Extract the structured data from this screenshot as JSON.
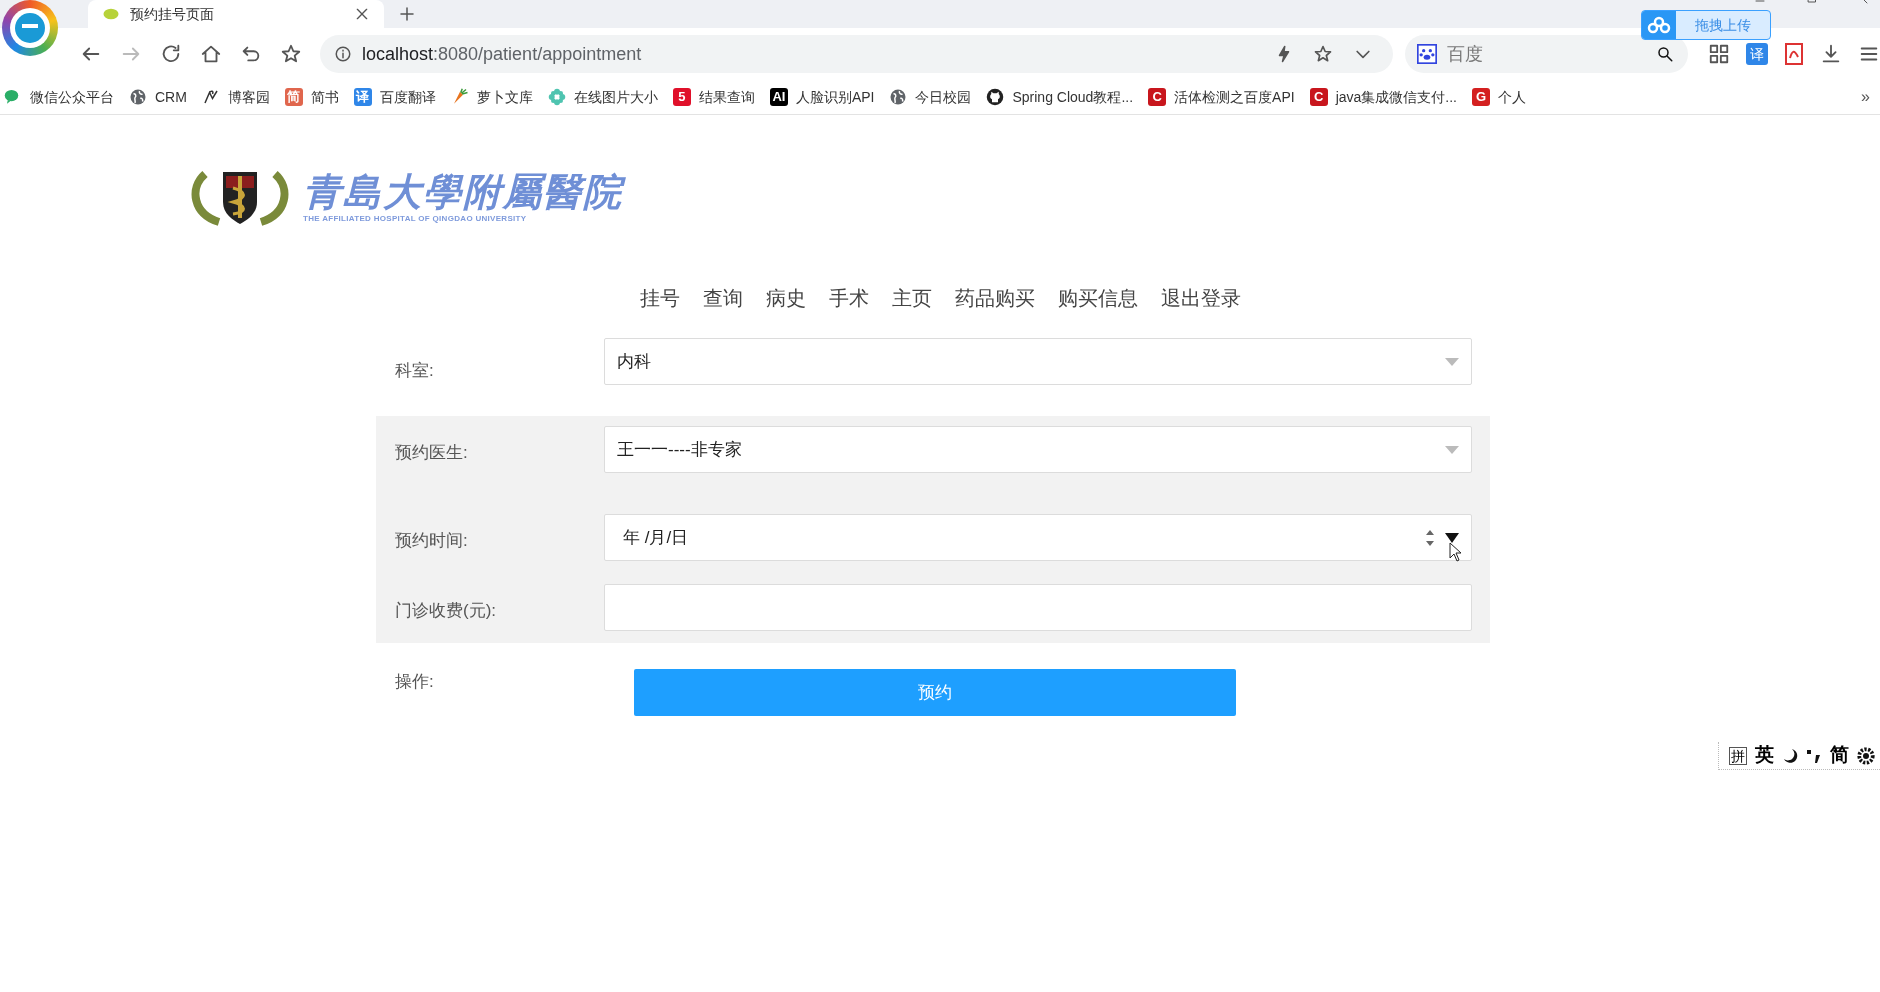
{
  "browser": {
    "tab_title": "预约挂号页面",
    "url_host": "localhost",
    "url_path": ":8080/patient/appointment",
    "search_placeholder": "百度",
    "upload_button": "拖拽上传",
    "translate_badge": "译",
    "bookmarks": [
      {
        "kind": "wechat",
        "label": "微信公众平台"
      },
      {
        "kind": "globe",
        "label": "CRM"
      },
      {
        "kind": "pen",
        "label": "博客园"
      },
      {
        "kind": "badge",
        "badge": "简",
        "color": "#e0664d",
        "label": "简书"
      },
      {
        "kind": "badge",
        "badge": "译",
        "color": "#2f86e8",
        "label": "百度翻译"
      },
      {
        "kind": "carrot",
        "label": "萝卜文库"
      },
      {
        "kind": "flower",
        "label": "在线图片大小"
      },
      {
        "kind": "badge",
        "badge": "5",
        "color": "#e0102a",
        "label": "结果查询"
      },
      {
        "kind": "badge",
        "badge": "AI",
        "color": "#000000",
        "label": "人脸识别API"
      },
      {
        "kind": "globe",
        "label": "今日校园"
      },
      {
        "kind": "github",
        "label": "Spring Cloud教程..."
      },
      {
        "kind": "badge",
        "badge": "C",
        "color": "#c8161d",
        "label": "活体检测之百度API"
      },
      {
        "kind": "badge",
        "badge": "C",
        "color": "#c8161d",
        "label": "java集成微信支付..."
      },
      {
        "kind": "badge",
        "badge": "G",
        "color": "#d42020",
        "label": "个人"
      }
    ],
    "more": "»"
  },
  "logo": {
    "title": "青島大學附屬醫院",
    "subtitle": "THE AFFILIATED HOSPITAL OF QINGDAO UNIVERSITY"
  },
  "nav": [
    "挂号",
    "查询",
    "病史",
    "手术",
    "主页",
    "药品购买",
    "购买信息",
    "退出登录"
  ],
  "form": {
    "rows": [
      {
        "kind": "select",
        "label": "科室:",
        "value": "内科",
        "shaded": false
      },
      {
        "kind": "select",
        "label": "预约医生:",
        "value": "王一一----非专家",
        "shaded": true
      },
      {
        "kind": "date",
        "label": "预约时间:",
        "value": "年 /月/日",
        "shaded": true
      },
      {
        "kind": "text",
        "label": "门诊收费(元):",
        "shaded": true
      }
    ],
    "action_label": "操作:",
    "submit": "预约"
  },
  "ime": {
    "mode": "拼",
    "chars": [
      "英",
      "简"
    ]
  }
}
